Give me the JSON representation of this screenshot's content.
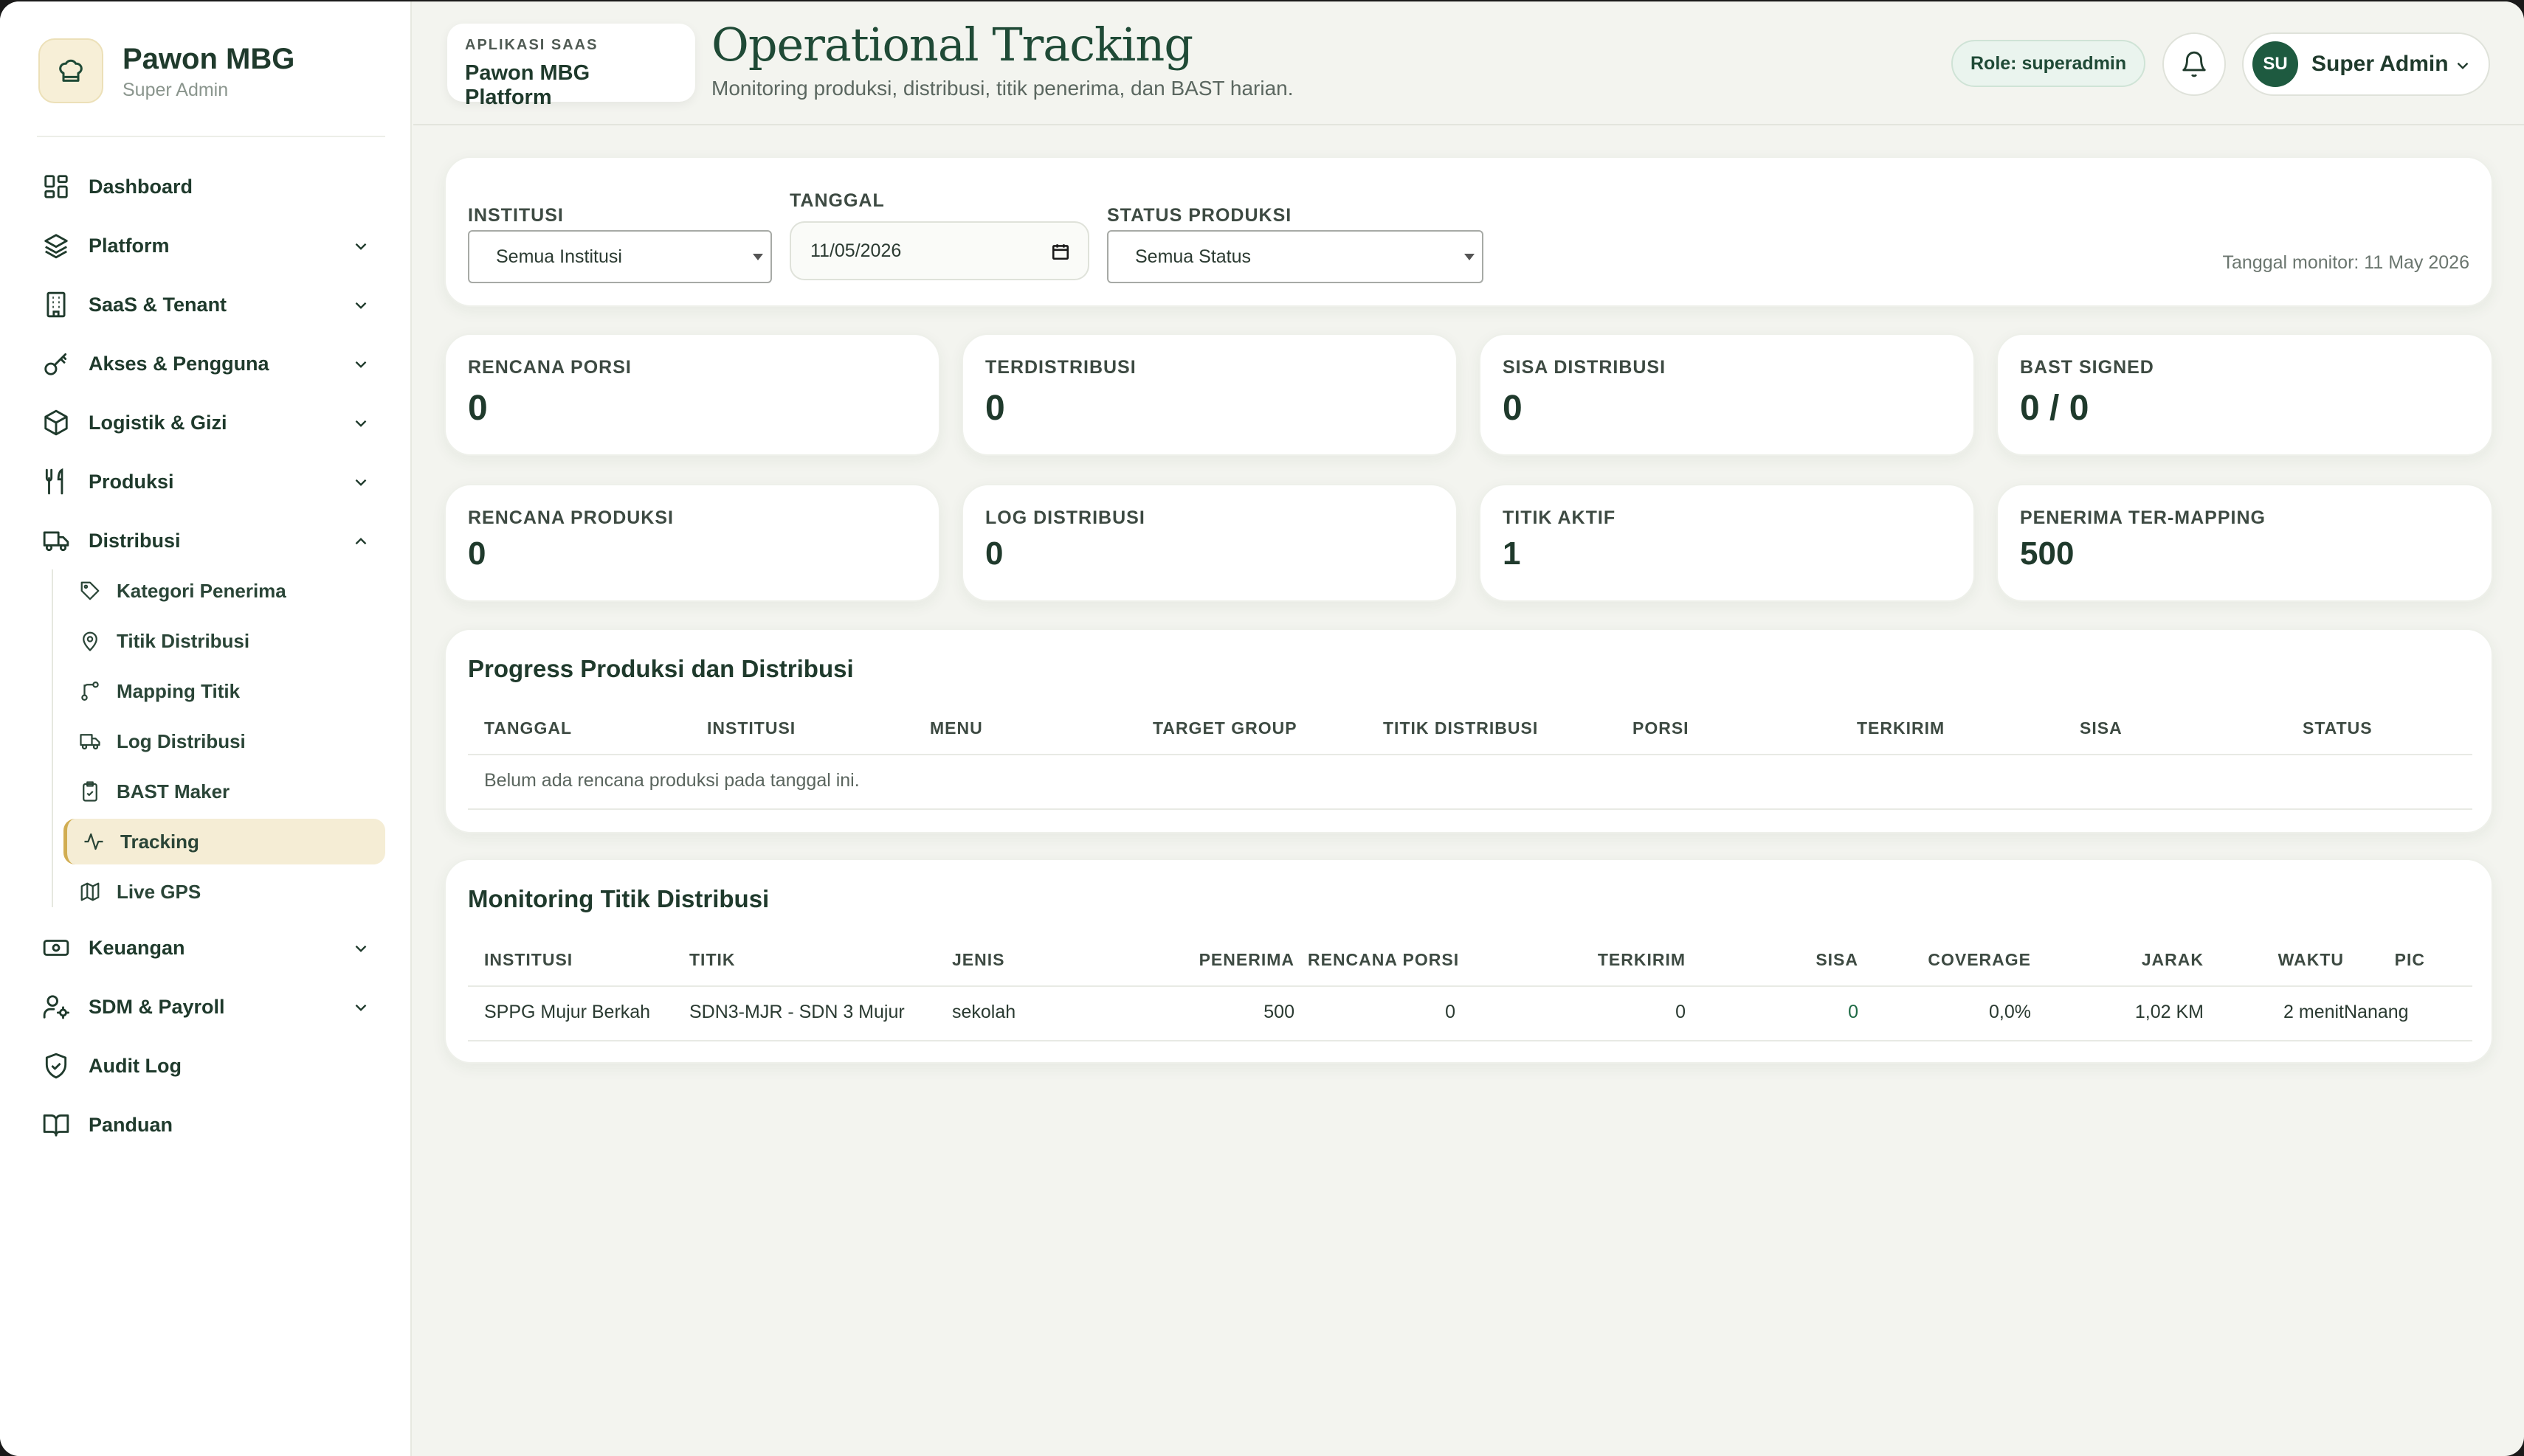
{
  "sidebar": {
    "brand_name": "Pawon MBG",
    "brand_sub": "Super Admin",
    "items": [
      {
        "label": "Dashboard"
      },
      {
        "label": "Platform"
      },
      {
        "label": "SaaS & Tenant"
      },
      {
        "label": "Akses & Pengguna"
      },
      {
        "label": "Logistik & Gizi"
      },
      {
        "label": "Produksi"
      },
      {
        "label": "Distribusi"
      },
      {
        "label": "Keuangan"
      },
      {
        "label": "SDM & Payroll"
      },
      {
        "label": "Audit Log"
      },
      {
        "label": "Panduan"
      }
    ],
    "sub_items": [
      {
        "label": "Kategori Penerima"
      },
      {
        "label": "Titik Distribusi"
      },
      {
        "label": "Mapping Titik"
      },
      {
        "label": "Log Distribusi"
      },
      {
        "label": "BAST Maker"
      },
      {
        "label": "Tracking"
      },
      {
        "label": "Live GPS"
      }
    ]
  },
  "header": {
    "app_kicker": "APLIKASI SAAS",
    "app_name": "Pawon MBG Platform",
    "title": "Operational Tracking",
    "subtitle": "Monitoring produksi, distribusi, titik penerima, dan BAST harian.",
    "role": "Role: superadmin",
    "avatar_initials": "SU",
    "user_name": "Super Admin"
  },
  "filters": {
    "institusi_label": "INSTITUSI",
    "institusi_value": "Semua Institusi",
    "tanggal_label": "TANGGAL",
    "tanggal_value": "11/05/2026",
    "status_label": "STATUS PRODUKSI",
    "status_value": "Semua Status",
    "monitor_text": "Tanggal monitor: 11 May 2026"
  },
  "stats": [
    {
      "label": "RENCANA PORSI",
      "value": "0"
    },
    {
      "label": "TERDISTRIBUSI",
      "value": "0"
    },
    {
      "label": "SISA DISTRIBUSI",
      "value": "0"
    },
    {
      "label": "BAST SIGNED",
      "value": "0 / 0"
    },
    {
      "label": "RENCANA PRODUKSI",
      "value": "0"
    },
    {
      "label": "LOG DISTRIBUSI",
      "value": "0"
    },
    {
      "label": "TITIK AKTIF",
      "value": "1"
    },
    {
      "label": "PENERIMA TER-MAPPING",
      "value": "500"
    }
  ],
  "progress": {
    "title": "Progress Produksi dan Distribusi",
    "columns": [
      "TANGGAL",
      "INSTITUSI",
      "MENU",
      "TARGET GROUP",
      "TITIK DISTRIBUSI",
      "PORSI",
      "TERKIRIM",
      "SISA",
      "STATUS"
    ],
    "empty_text": "Belum ada rencana produksi pada tanggal ini."
  },
  "monitoring": {
    "title": "Monitoring Titik Distribusi",
    "columns": [
      "INSTITUSI",
      "TITIK",
      "JENIS",
      "PENERIMA",
      "RENCANA PORSI",
      "TERKIRIM",
      "SISA",
      "COVERAGE",
      "JARAK",
      "WAKTU",
      "PIC"
    ],
    "rows": [
      [
        "SPPG Mujur Berkah",
        "SDN3-MJR - SDN 3 Mujur",
        "sekolah",
        "500",
        "0",
        "0",
        "0",
        "0,0%",
        "1,02 KM",
        "2 menit",
        "Nanang"
      ]
    ]
  },
  "colors": {
    "primary": "#1f4a36",
    "accent": "#d1ad52",
    "background": "#f3f4ef",
    "active_bg": "#f5edd5"
  }
}
